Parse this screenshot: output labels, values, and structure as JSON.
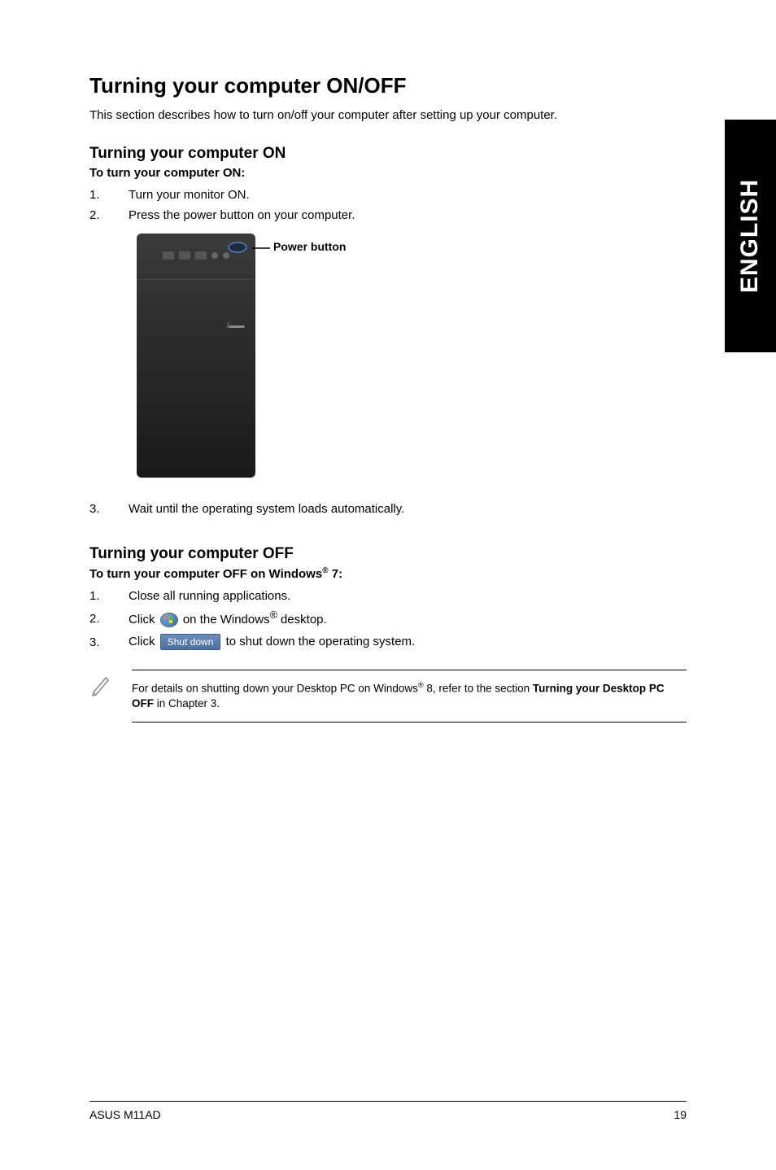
{
  "sideTab": "ENGLISH",
  "heading": "Turning your computer ON/OFF",
  "intro": "This section describes how to turn on/off your computer after setting up your computer.",
  "on": {
    "heading": "Turning your computer ON",
    "subhead": "To turn your computer ON:",
    "steps": [
      {
        "num": "1.",
        "text": "Turn your monitor ON."
      },
      {
        "num": "2.",
        "text": "Press the power button on your computer."
      },
      {
        "num": "3.",
        "text": "Wait until the operating system loads automatically."
      }
    ],
    "annotation": "Power button"
  },
  "off": {
    "heading": "Turning your computer OFF",
    "subhead_pre": "To turn your computer OFF on Windows",
    "subhead_sup": "®",
    "subhead_post": " 7:",
    "steps": {
      "s1": {
        "num": "1.",
        "text": "Close all running applications."
      },
      "s2": {
        "num": "2.",
        "pre": "Click ",
        "post_pre": " on the Windows",
        "sup": "®",
        "post": " desktop."
      },
      "s3": {
        "num": "3.",
        "pre": "Click ",
        "btn": "Shut down",
        "post": " to shut down the operating system."
      }
    }
  },
  "note": {
    "pre": "For details on shutting down your Desktop PC on Windows",
    "sup": "®",
    "mid": " 8, refer to the section ",
    "bold1": "Turning your Desktop PC OFF",
    "post": " in Chapter 3."
  },
  "footer": {
    "left": "ASUS M11AD",
    "right": "19"
  }
}
